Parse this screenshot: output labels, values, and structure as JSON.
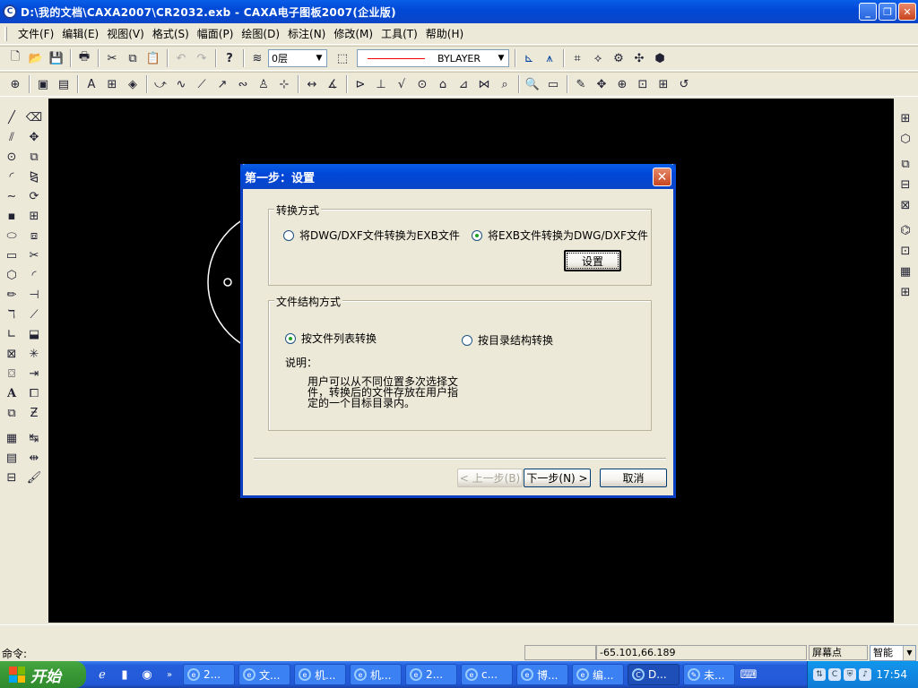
{
  "window": {
    "title": "D:\\我的文档\\CAXA2007\\CR2032.exb - CAXA电子图板2007(企业版)",
    "app_icon": "caxa-logo-icon",
    "buttons": {
      "minimize": "_",
      "restore": "❐",
      "close": "✕"
    }
  },
  "menu": [
    {
      "label": "文件(F)"
    },
    {
      "label": "编辑(E)"
    },
    {
      "label": "视图(V)"
    },
    {
      "label": "格式(S)"
    },
    {
      "label": "幅面(P)"
    },
    {
      "label": "绘图(D)"
    },
    {
      "label": "标注(N)"
    },
    {
      "label": "修改(M)"
    },
    {
      "label": "工具(T)"
    },
    {
      "label": "帮助(H)"
    }
  ],
  "toolbar": {
    "layer": "0层",
    "linetype": "BYLAYER",
    "colors": {
      "line_sample": "#ff0000"
    }
  },
  "dialog": {
    "title": "第一步：设置",
    "close": "✕",
    "group1": {
      "label": "转换方式",
      "option1": "将DWG/DXF文件转换为EXB文件",
      "option2": "将EXB文件转换为DWG/DXF文件",
      "settings_button": "设置"
    },
    "group2": {
      "label": "文件结构方式",
      "option1": "按文件列表转换",
      "option2": "按目录结构转换",
      "note_label": "说明：",
      "note_text": "用户可以从不同位置多次选择文件，转换后的文件存放在用户指定的一个目标目录内。"
    },
    "buttons": {
      "back": "< 上一步(B)",
      "next": "下一步(N) >",
      "cancel": "取消"
    }
  },
  "status": {
    "command_label": "命令:",
    "coordinates": "-65.101,66.189",
    "snap_mode": "屏幕点",
    "smart_select": "智能"
  },
  "taskbar": {
    "start": "开始",
    "tasks": [
      {
        "label": "2..."
      },
      {
        "label": "文..."
      },
      {
        "label": "机..."
      },
      {
        "label": "机..."
      },
      {
        "label": "2..."
      },
      {
        "label": "c..."
      },
      {
        "label": "博..."
      },
      {
        "label": "编..."
      },
      {
        "label": "D..."
      },
      {
        "label": "未..."
      }
    ],
    "clock": "17:54"
  }
}
